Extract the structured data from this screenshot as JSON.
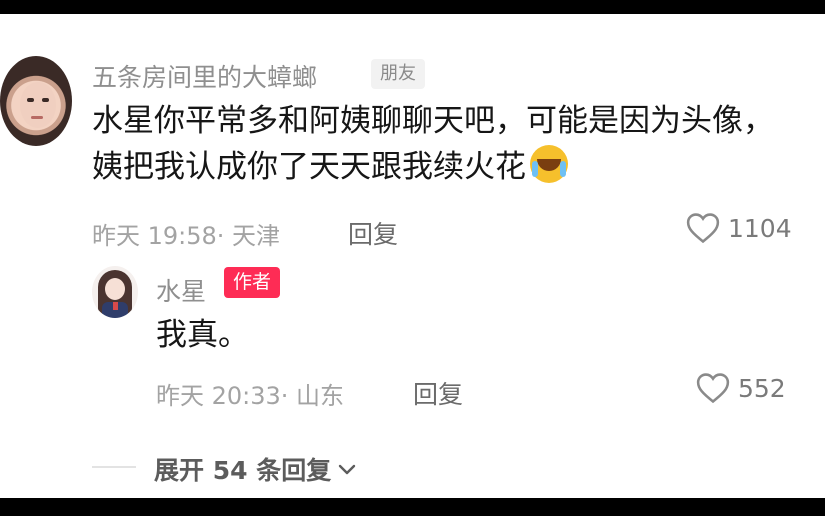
{
  "comment": {
    "username": "五条房间里的大蟑螂",
    "relation_badge": "朋友",
    "text_line1": "水星你平常多和阿姨聊聊天吧，可能是因为头像，",
    "text_line2": "姨把我认成你了天天跟我续火花",
    "emoji": "sob-icon",
    "time": "昨天 19:58",
    "location": "· 天津",
    "reply_label": "回复",
    "likes": "1104"
  },
  "reply": {
    "username": "水星",
    "author_badge": "作者",
    "text": "我真。",
    "time": "昨天 20:33",
    "location": "· 山东",
    "reply_label": "回复",
    "likes": "552"
  },
  "expand": {
    "label": "展开 54 条回复"
  },
  "colors": {
    "author_badge": "#fe2c55",
    "text": "#161616",
    "muted": "#a3a3a3"
  }
}
